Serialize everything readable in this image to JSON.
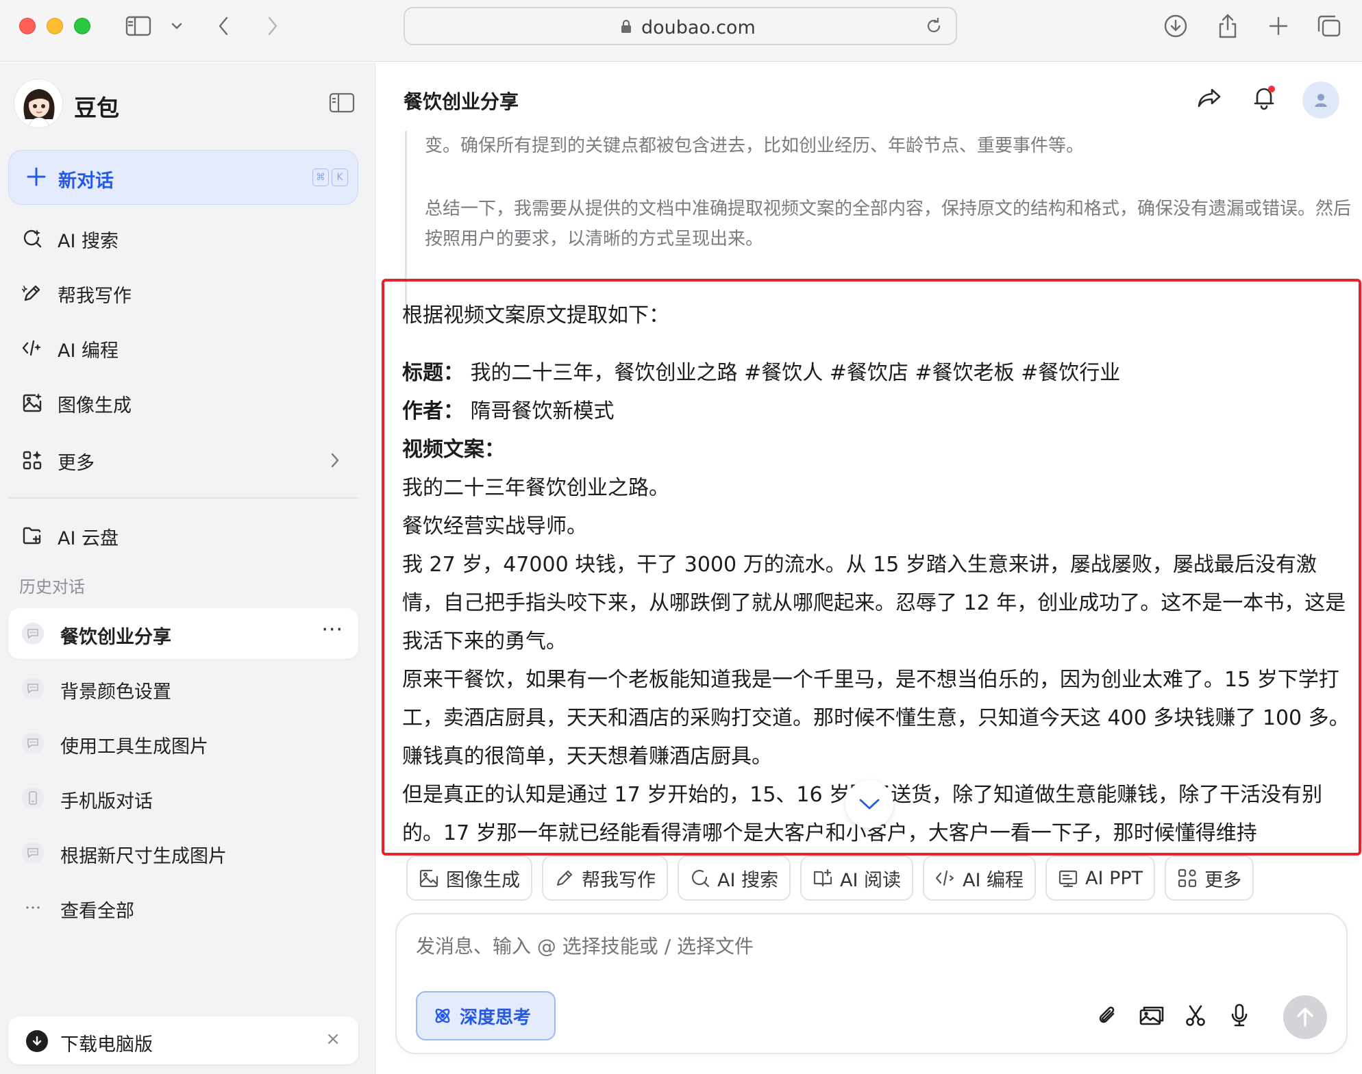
{
  "browser": {
    "url": "doubao.com"
  },
  "sidebar": {
    "brand": "豆包",
    "new_chat": {
      "label": "新对话",
      "shortcut": [
        "⌘",
        "K"
      ]
    },
    "nav": [
      {
        "label": "AI 搜索",
        "icon": "search-sparkle-icon"
      },
      {
        "label": "帮我写作",
        "icon": "pen-icon"
      },
      {
        "label": "AI 编程",
        "icon": "code-icon"
      },
      {
        "label": "图像生成",
        "icon": "image-icon"
      },
      {
        "label": "更多",
        "icon": "grid-icon"
      }
    ],
    "cloud": {
      "label": "AI 云盘",
      "icon": "cloud-folder-icon"
    },
    "history_title": "历史对话",
    "history": [
      {
        "label": "餐饮创业分享",
        "active": true
      },
      {
        "label": "背景颜色设置"
      },
      {
        "label": "使用工具生成图片"
      },
      {
        "label": "手机版对话"
      },
      {
        "label": "根据新尺寸生成图片"
      },
      {
        "label": "查看全部"
      }
    ],
    "download": {
      "label": "下载电脑版",
      "close": "×"
    }
  },
  "main": {
    "title": "餐饮创业分享",
    "thinking": [
      "变。确保所有提到的关键点都被包含进去，比如创业经历、年龄节点、重要事件等。",
      "总结一下，我需要从提供的文档中准确提取视频文案的全部内容，保持原文的结构和格式，确保没有遗漏或错误。然后按照用户的要求，以清晰的方式呈现出来。"
    ],
    "answer": {
      "intro": "根据视频文案原文提取如下：",
      "title_key": "标题：",
      "title_val": "我的二十三年，餐饮创业之路 #餐饮人 #餐饮店 #餐饮老板 #餐饮行业",
      "author_key": "作者：",
      "author_val": "隋哥餐饮新模式",
      "script_key": "视频文案：",
      "lines": [
        "我的二十三年餐饮创业之路。",
        "餐饮经营实战导师。",
        "我 27 岁，47000 块钱，干了 3000 万的流水。从 15 岁踏入生意来讲，屡战屡败，屡战最后没有激情，自己把手指头咬下来，从哪跌倒了就从哪爬起来。忍辱了 12 年，创业成功了。这不是一本书，这是我活下来的勇气。",
        "原来干餐饮，如果有一个老板能知道我是一个千里马，是不想当伯乐的，因为创业太难了。15 岁下学打工，卖酒店厨具，天天和酒店的采购打交道。那时候不懂生意，只知道今天这 400 多块钱赚了 100 多。赚钱真的很简单，天天想着赚酒店厨具。",
        "但是真正的认知是通过 17 岁开始的，15、16 岁除了送货，除了知道做生意能赚钱，除了干活没有别的。17 岁那一年就已经能看得清哪个是大客户和小客户，大客户一看一下子，那时候懂得维持"
      ]
    },
    "chips": [
      {
        "label": "图像生成",
        "icon": "image-icon"
      },
      {
        "label": "帮我写作",
        "icon": "pen-icon"
      },
      {
        "label": "AI 搜索",
        "icon": "search-sparkle-icon"
      },
      {
        "label": "AI 阅读",
        "icon": "book-icon"
      },
      {
        "label": "AI 编程",
        "icon": "code-icon"
      },
      {
        "label": "AI PPT",
        "icon": "slides-icon"
      },
      {
        "label": "更多",
        "icon": "grid-icon"
      }
    ],
    "composer": {
      "placeholder": "发消息、输入 @ 选择技能或 / 选择文件",
      "deep_think": "深度思考"
    }
  },
  "colors": {
    "accent": "#2659e8",
    "highlight_border": "#e8222b",
    "sidebar_bg": "#f3f3f5"
  }
}
